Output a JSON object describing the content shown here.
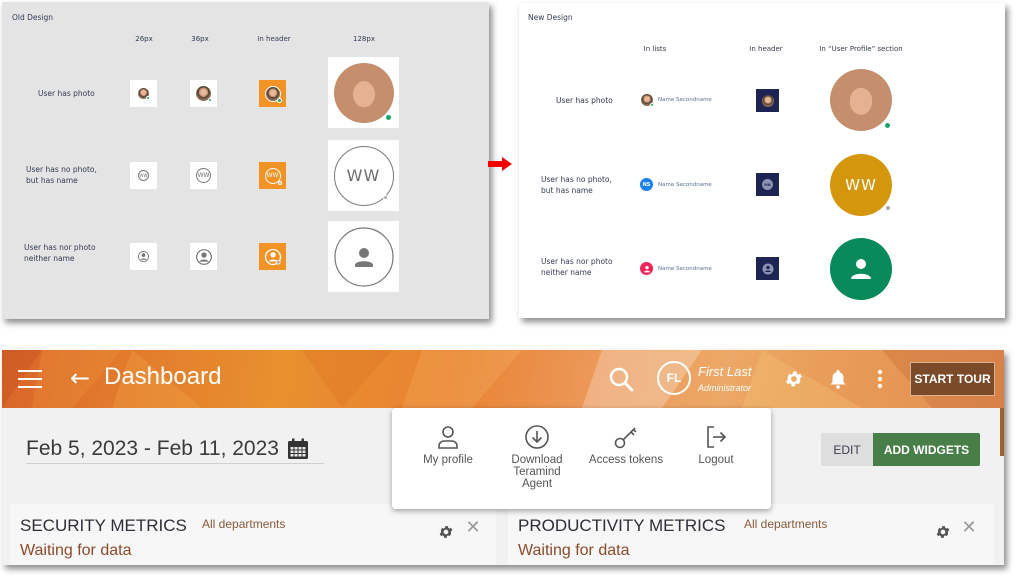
{
  "old_design": {
    "title": "Old Design",
    "columns": [
      "26px",
      "36px",
      "In header",
      "128px"
    ],
    "rows": [
      {
        "label": "User has photo",
        "status": "online"
      },
      {
        "label": "User has no photo,\nbut has name",
        "initials": "WW",
        "status": "offline"
      },
      {
        "label": "User has nor photo\nneither name",
        "status": "offline"
      }
    ]
  },
  "new_design": {
    "title": "New Design",
    "columns": [
      "In lists",
      "In header",
      "In “User Profile” section"
    ],
    "rows": [
      {
        "label": "User has photo",
        "list_name": "Name Secondname",
        "status": "online"
      },
      {
        "label": "User has no photo,\nbut has name",
        "list_name": "Name Secondname",
        "list_initials": "NS",
        "header_initials": "MN",
        "profile_initials": "WW",
        "status": "offline"
      },
      {
        "label": "User has nor photo\nneither name",
        "list_name": "Name Secondname"
      }
    ],
    "colors": {
      "list_initials_bg": "#1a82f0",
      "list_noname_bg": "#f0255a",
      "header_bg": "#1d2454",
      "profile_initials_bg": "#d4960a",
      "profile_noname_bg": "#088a5a"
    }
  },
  "arrow_color": "#f20000",
  "app": {
    "header": {
      "title": "Dashboard",
      "user_initials": "FL",
      "user_name": "First Last",
      "user_role": "Administrator",
      "start_tour_label": "START TOUR"
    },
    "date_range": "Feb 5, 2023 - Feb 11, 2023",
    "buttons": {
      "edit": "EDIT",
      "add_widgets": "ADD WIDGETS"
    },
    "user_menu": [
      {
        "label": "My profile",
        "icon": "user-icon"
      },
      {
        "label": "Download\nTeramind\nAgent",
        "icon": "download-icon"
      },
      {
        "label": "Access tokens",
        "icon": "key-icon"
      },
      {
        "label": "Logout",
        "icon": "logout-icon"
      }
    ],
    "widgets": [
      {
        "title": "SECURITY METRICS",
        "department": "All departments",
        "status": "Waiting for data"
      },
      {
        "title": "PRODUCTIVITY METRICS",
        "department": "All departments",
        "status": "Waiting for data"
      }
    ],
    "colors": {
      "header_orange": "#e8862e",
      "start_tour_bg": "#7b4a28",
      "add_widgets_bg": "#487e47",
      "status_text": "#8b4a28"
    }
  }
}
